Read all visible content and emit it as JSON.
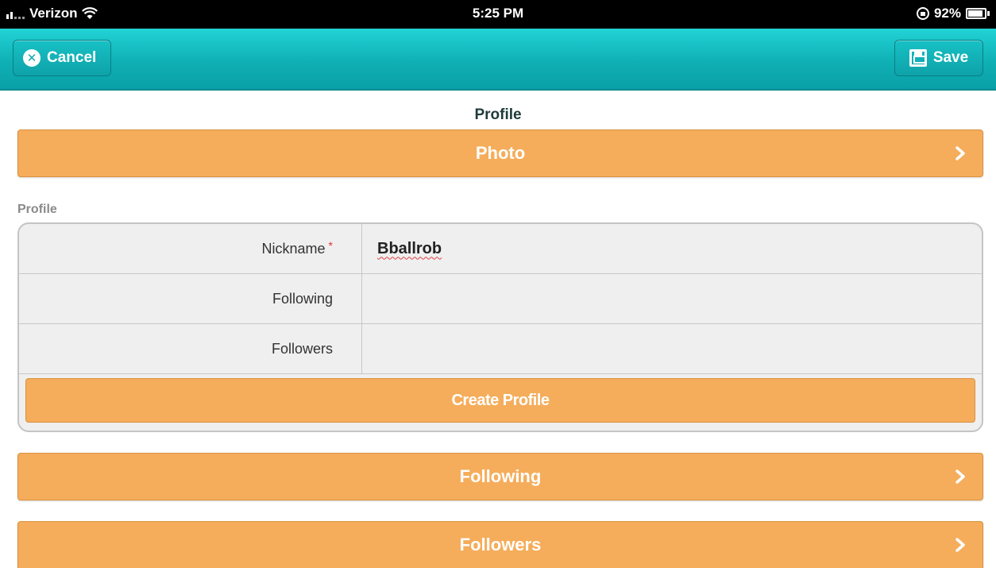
{
  "status_bar": {
    "carrier": "Verizon",
    "time": "5:25 PM",
    "battery": "92%"
  },
  "header": {
    "cancel_label": "Cancel",
    "save_label": "Save"
  },
  "page_title": "Profile",
  "photo_bar": {
    "label": "Photo"
  },
  "profile_section": {
    "label": "Profile",
    "rows": [
      {
        "label": "Nickname",
        "required_mark": "*",
        "value": "Bballrob"
      },
      {
        "label": "Following",
        "value": ""
      },
      {
        "label": "Followers",
        "value": ""
      }
    ],
    "create_button_label": "Create Profile"
  },
  "following_bar": {
    "label": "Following"
  },
  "followers_bar": {
    "label": "Followers"
  },
  "colors": {
    "header": "#15bdc2",
    "orange": "#f5ad5b"
  }
}
